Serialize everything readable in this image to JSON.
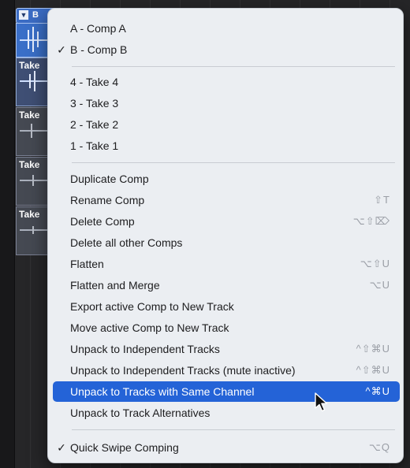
{
  "tracks": {
    "header_label": "B",
    "takes": [
      {
        "label": "Take"
      },
      {
        "label": "Take"
      },
      {
        "label": "Take"
      },
      {
        "label": "Take"
      }
    ]
  },
  "menu": {
    "comps": [
      {
        "label": "A - Comp A",
        "checked": false
      },
      {
        "label": "B - Comp B",
        "checked": true
      }
    ],
    "takes": [
      {
        "label": "4 - Take 4"
      },
      {
        "label": "3 - Take 3"
      },
      {
        "label": "2 - Take 2"
      },
      {
        "label": "1 - Take 1"
      }
    ],
    "actions": [
      {
        "label": "Duplicate Comp",
        "shortcut": ""
      },
      {
        "label": "Rename Comp",
        "shortcut": "⇧T"
      },
      {
        "label": "Delete Comp",
        "shortcut": "⌥⇧⌦"
      },
      {
        "label": "Delete all other Comps",
        "shortcut": ""
      },
      {
        "label": "Flatten",
        "shortcut": "⌥⇧U"
      },
      {
        "label": "Flatten and Merge",
        "shortcut": "⌥U"
      },
      {
        "label": "Export active Comp to New Track",
        "shortcut": ""
      },
      {
        "label": "Move active Comp to New Track",
        "shortcut": ""
      },
      {
        "label": "Unpack to Independent Tracks",
        "shortcut": "^⇧⌘U"
      },
      {
        "label": "Unpack to Independent Tracks (mute inactive)",
        "shortcut": "^⇧⌘U"
      },
      {
        "label": "Unpack to Tracks with Same Channel",
        "shortcut": "^⌘U"
      },
      {
        "label": "Unpack to Track Alternatives",
        "shortcut": ""
      }
    ],
    "quick_swipe": {
      "label": "Quick Swipe Comping",
      "shortcut": "⌥Q",
      "checked": true
    },
    "check_glyph": "✓",
    "highlight_color": "#2463d7"
  }
}
